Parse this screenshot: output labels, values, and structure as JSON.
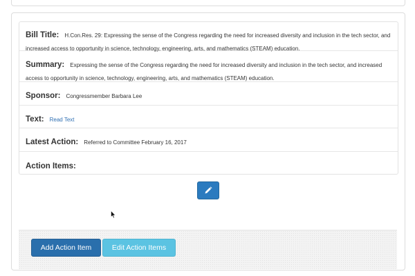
{
  "bill": {
    "title_label": "Bill Title:",
    "title_value": "H.Con.Res. 29: Expressing the sense of the Congress regarding the need for increased diversity and inclusion in the tech sector, and increased access to opportunity in science, technology, engineering, arts, and mathematics (STEAM) education.",
    "summary_label": "Summary:",
    "summary_value": "Expressing the sense of the Congress regarding the need for increased diversity and inclusion in the tech sector, and increased access to opportunity in science, technology, engineering, arts, and mathematics (STEAM) education.",
    "sponsor_label": "Sponsor:",
    "sponsor_value": "Congressmember Barbara Lee",
    "text_label": "Text:",
    "text_link": "Read Text",
    "latest_action_label": "Latest Action:",
    "latest_action_value": "Referred to Committee February 16, 2017",
    "action_items_label": "Action Items:"
  },
  "actions": {
    "edit_icon": "pencil-icon",
    "add_action_item_label": "Add Action Item",
    "edit_action_items_label": "Edit Action Items"
  },
  "colors": {
    "primary": "#2a6fac",
    "info": "#5bc3e2",
    "link": "#2f6fb3"
  }
}
